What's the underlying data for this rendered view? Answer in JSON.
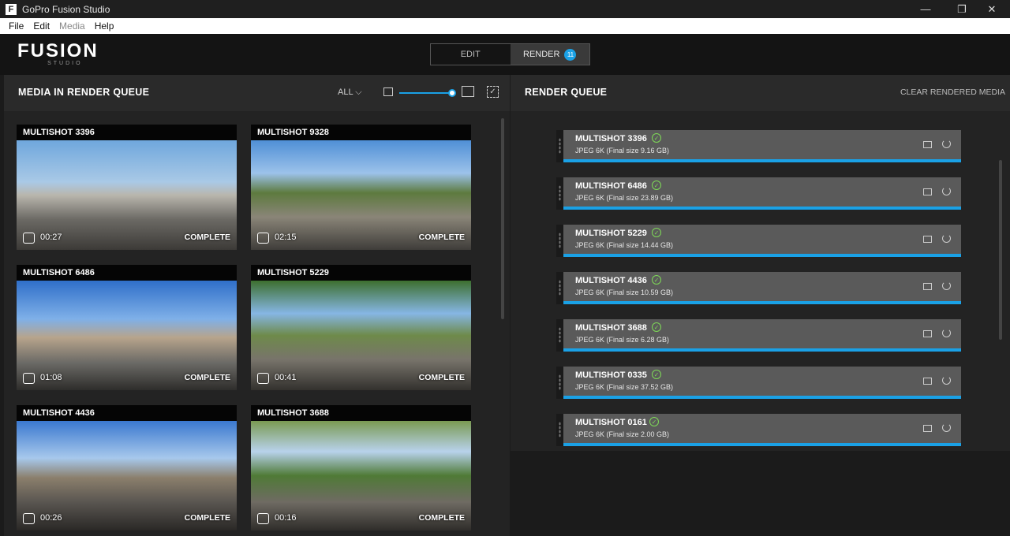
{
  "window": {
    "title": "GoPro Fusion Studio",
    "app_icon": "F",
    "controls": [
      "—",
      "❐",
      "✕"
    ]
  },
  "menu": [
    {
      "label": "File",
      "disabled": false
    },
    {
      "label": "Edit",
      "disabled": false
    },
    {
      "label": "Media",
      "disabled": true
    },
    {
      "label": "Help",
      "disabled": false
    }
  ],
  "logo": {
    "main": "FUSION",
    "sub": "STUDIO"
  },
  "mode_switch": {
    "edit_label": "EDIT",
    "render_label": "RENDER",
    "render_badge": "11"
  },
  "media_panel": {
    "title": "MEDIA IN RENDER QUEUE",
    "filter_label": "ALL ⌵",
    "select_icon": "✓",
    "cards": [
      {
        "name": "MULTISHOT 3396",
        "duration": "00:27",
        "status": "COMPLETE"
      },
      {
        "name": "MULTISHOT 9328",
        "duration": "02:15",
        "status": "COMPLETE"
      },
      {
        "name": "MULTISHOT 6486",
        "duration": "01:08",
        "status": "COMPLETE"
      },
      {
        "name": "MULTISHOT 5229",
        "duration": "00:41",
        "status": "COMPLETE"
      },
      {
        "name": "MULTISHOT 4436",
        "duration": "00:26",
        "status": "COMPLETE"
      },
      {
        "name": "MULTISHOT 3688",
        "duration": "00:16",
        "status": "COMPLETE"
      }
    ]
  },
  "queue_panel": {
    "title": "RENDER QUEUE",
    "clear_label": "CLEAR RENDERED MEDIA",
    "check_glyph": "✓",
    "items": [
      {
        "name": "MULTISHOT 3396",
        "info": "JPEG 6K  (Final size 9.16 GB)"
      },
      {
        "name": "MULTISHOT 6486",
        "info": "JPEG 6K  (Final size 23.89 GB)"
      },
      {
        "name": "MULTISHOT 5229",
        "info": "JPEG 6K  (Final size 14.44 GB)"
      },
      {
        "name": "MULTISHOT 4436",
        "info": "JPEG 6K  (Final size 10.59 GB)"
      },
      {
        "name": "MULTISHOT 3688",
        "info": "JPEG 6K  (Final size 6.28 GB)"
      },
      {
        "name": "MULTISHOT 0335",
        "info": "JPEG 6K  (Final size 37.52 GB)"
      },
      {
        "name": "MULTISHOT 0161",
        "info": "JPEG 6K  (Final size 2.00 GB)"
      }
    ]
  },
  "colors": {
    "accent": "#1aa1e6",
    "complete": "#7ed957",
    "queue_item_bg": "#5a5a5a"
  }
}
